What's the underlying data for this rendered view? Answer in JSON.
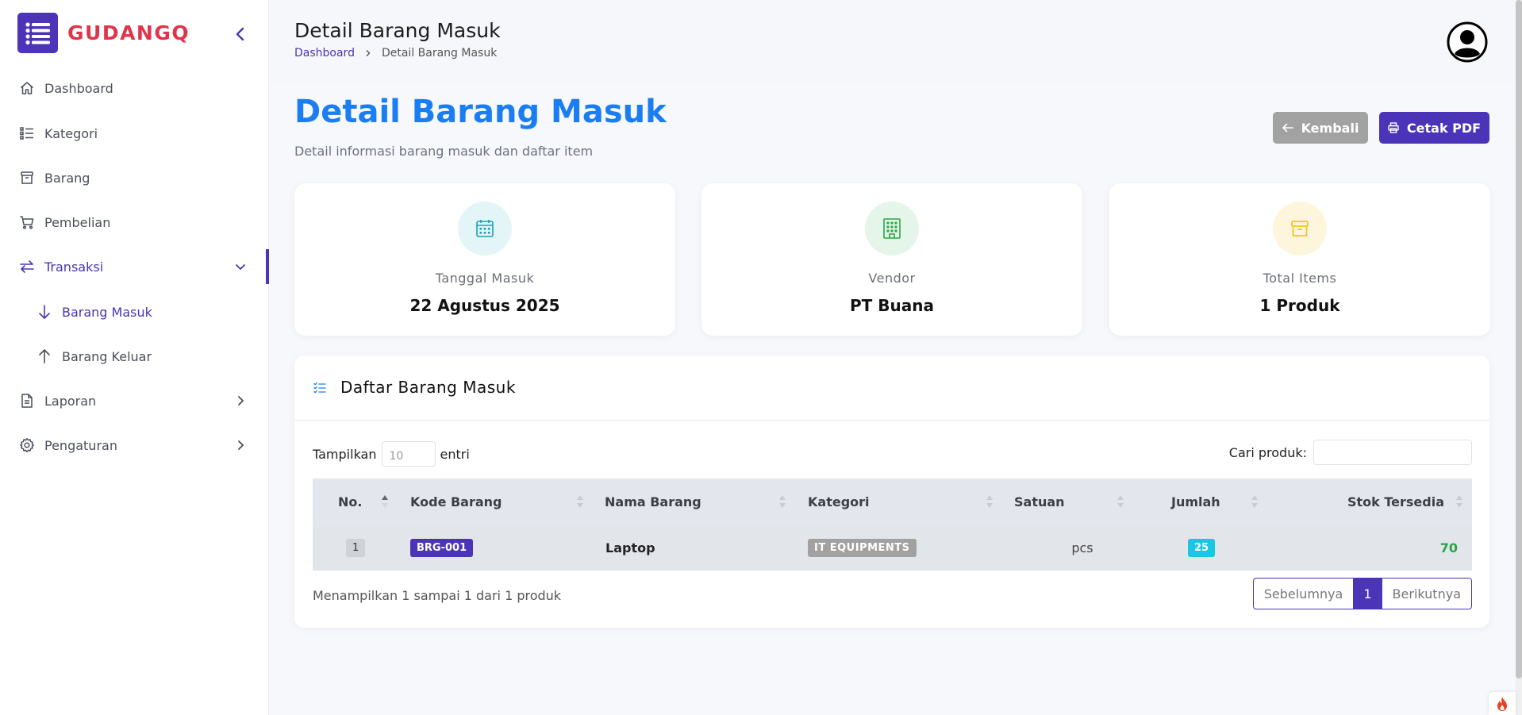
{
  "brand": {
    "name": "GUDANGQ",
    "logo_icon": "menu-lines-icon"
  },
  "sidebar": {
    "items": [
      {
        "label": "Dashboard",
        "icon": "home-icon"
      },
      {
        "label": "Kategori",
        "icon": "list-icon"
      },
      {
        "label": "Barang",
        "icon": "box-icon"
      },
      {
        "label": "Pembelian",
        "icon": "cart-icon"
      },
      {
        "label": "Transaksi",
        "icon": "exchange-icon",
        "expanded": true,
        "active": true,
        "children": [
          {
            "label": "Barang Masuk",
            "icon": "arrow-down-icon",
            "current": true
          },
          {
            "label": "Barang Keluar",
            "icon": "arrow-up-icon"
          }
        ]
      },
      {
        "label": "Laporan",
        "icon": "document-icon"
      },
      {
        "label": "Pengaturan",
        "icon": "gear-icon"
      }
    ]
  },
  "header": {
    "title": "Detail Barang Masuk",
    "breadcrumb": {
      "home": "Dashboard",
      "current": "Detail Barang Masuk"
    }
  },
  "page": {
    "title": "Detail Barang Masuk",
    "subtitle": "Detail informasi barang masuk dan daftar item",
    "back_label": "Kembali",
    "pdf_label": "Cetak PDF"
  },
  "stats": [
    {
      "label": "Tanggal Masuk",
      "value": "22 Agustus 2025",
      "icon": "calendar-icon",
      "color": "#17a2b8",
      "bg": "#e3f5f7"
    },
    {
      "label": "Vendor",
      "value": "PT Buana",
      "icon": "building-icon",
      "color": "#28a745",
      "bg": "#e6f5ea"
    },
    {
      "label": "Total Items",
      "value": "1 Produk",
      "icon": "box-icon",
      "color": "#f5c518",
      "bg": "#fdf6dc"
    }
  ],
  "table_panel": {
    "title": "Daftar Barang Masuk",
    "length_prefix": "Tampilkan",
    "length_value": "10",
    "length_suffix": "entri",
    "search_label": "Cari produk:",
    "columns": [
      "No.",
      "Kode Barang",
      "Nama Barang",
      "Kategori",
      "Satuan",
      "Jumlah",
      "Stok Tersedia"
    ],
    "rows": [
      {
        "no": "1",
        "kode": "BRG-001",
        "nama": "Laptop",
        "kategori": "IT EQUIPMENTS",
        "satuan": "pcs",
        "jumlah": "25",
        "stok": "70"
      }
    ],
    "info": "Menampilkan 1 sampai 1 dari 1 produk",
    "pagination": {
      "prev": "Sebelumnya",
      "page": "1",
      "next": "Berikutnya"
    }
  },
  "colors": {
    "primary": "#4b34b7",
    "brand_red": "#e0344b",
    "title_blue": "#1a7ef2",
    "stock_green": "#28a745",
    "qty_cyan": "#1ac6e6"
  }
}
